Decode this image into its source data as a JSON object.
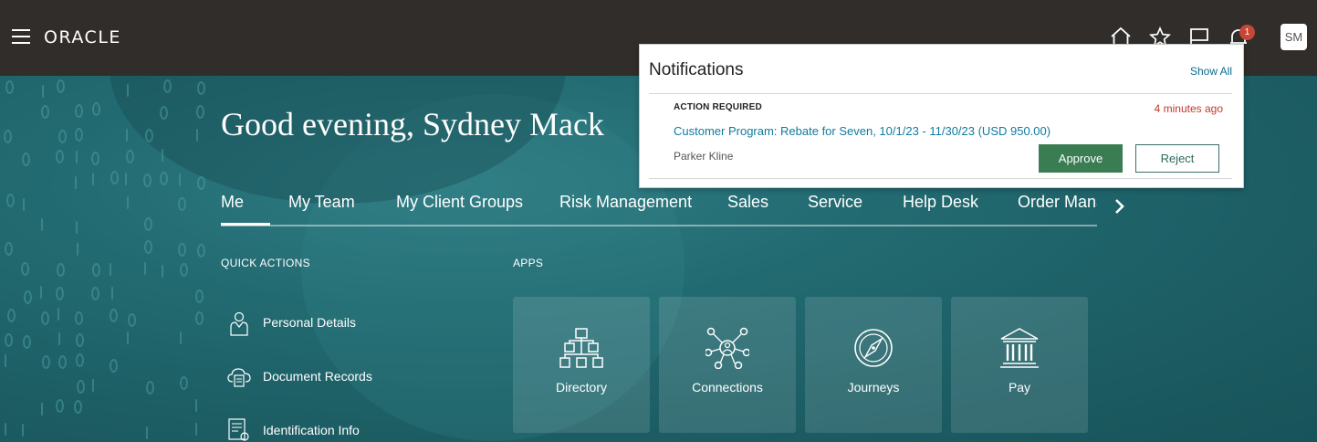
{
  "header": {
    "brand": "ORACLE",
    "avatar_initials": "SM",
    "notification_count": "1",
    "icons": [
      "menu-icon",
      "home-icon",
      "star-icon",
      "flag-icon",
      "bell-icon"
    ]
  },
  "greeting": "Good evening, Sydney Mack",
  "tabs": [
    "Me",
    "My Team",
    "My Client Groups",
    "Risk Management",
    "Sales",
    "Service",
    "Help Desk",
    "Order Mana"
  ],
  "quick_actions": {
    "label": "QUICK ACTIONS",
    "items": [
      {
        "label": "Personal Details",
        "icon": "person-icon"
      },
      {
        "label": "Document Records",
        "icon": "cloud-document-icon"
      },
      {
        "label": "Identification Info",
        "icon": "id-card-icon"
      }
    ]
  },
  "apps": {
    "label": "APPS",
    "items": [
      {
        "label": "Directory",
        "icon": "org-chart-icon"
      },
      {
        "label": "Connections",
        "icon": "network-icon"
      },
      {
        "label": "Journeys",
        "icon": "compass-icon"
      },
      {
        "label": "Pay",
        "icon": "bank-icon"
      }
    ]
  },
  "notifications": {
    "title": "Notifications",
    "show_all": "Show All",
    "item": {
      "kind": "ACTION REQUIRED",
      "time": "4 minutes ago",
      "subject": "Customer Program: Rebate for Seven, 10/1/23 - 11/30/23 (USD 950.00)",
      "from": "Parker Kline",
      "approve": "Approve",
      "reject": "Reject"
    }
  },
  "colors": {
    "header_bg": "#312d2a",
    "hero_teal": "#226a71",
    "approve_green": "#3a7d53",
    "badge_red": "#c74634",
    "link_blue": "#0f7aa0"
  }
}
